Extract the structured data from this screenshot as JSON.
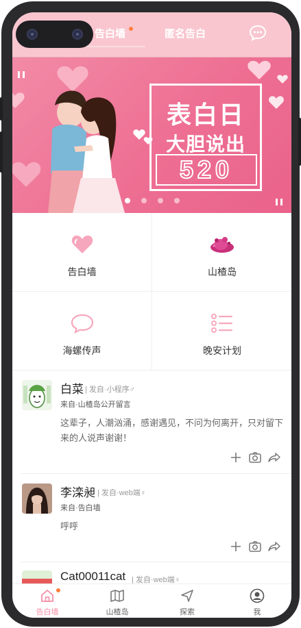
{
  "header": {
    "tab_active": "告白墙",
    "tab_anonymous": "匿名告白"
  },
  "banner": {
    "line1": "表白日",
    "line2": "大胆说出",
    "number": "520",
    "slide_count": 4,
    "active_slide": 1
  },
  "features": [
    {
      "label": "告白墙",
      "icon": "heart-icon"
    },
    {
      "label": "山楂岛",
      "icon": "island-icon"
    },
    {
      "label": "海螺传声",
      "icon": "chat-bubble-icon"
    },
    {
      "label": "晚安计划",
      "icon": "list-icon"
    }
  ],
  "posts": [
    {
      "name": "白菜",
      "meta": "| 发自·小程序♂",
      "from": "来自·山楂岛公开留言",
      "body": "这辈子，人潮汹涌，感谢遇见，不问为何离开，只对留下来的人说声谢谢！"
    },
    {
      "name": "李滦昶",
      "meta": "| 发自·web端♀",
      "from": "来自·告白墙",
      "body": "呼呼"
    },
    {
      "name": "Cat00011cat",
      "meta": "| 发自·web端♀"
    }
  ],
  "nav": [
    {
      "label": "告白墙",
      "icon": "home-icon"
    },
    {
      "label": "山楂岛",
      "icon": "map-icon"
    },
    {
      "label": "探索",
      "icon": "send-icon"
    },
    {
      "label": "我",
      "icon": "user-icon"
    }
  ],
  "colors": {
    "header_bg": "#f9c6cf",
    "accent_pink": "#f48ea4",
    "badge_orange": "#ff7f3f",
    "banner_pink": "#ee6f93"
  }
}
